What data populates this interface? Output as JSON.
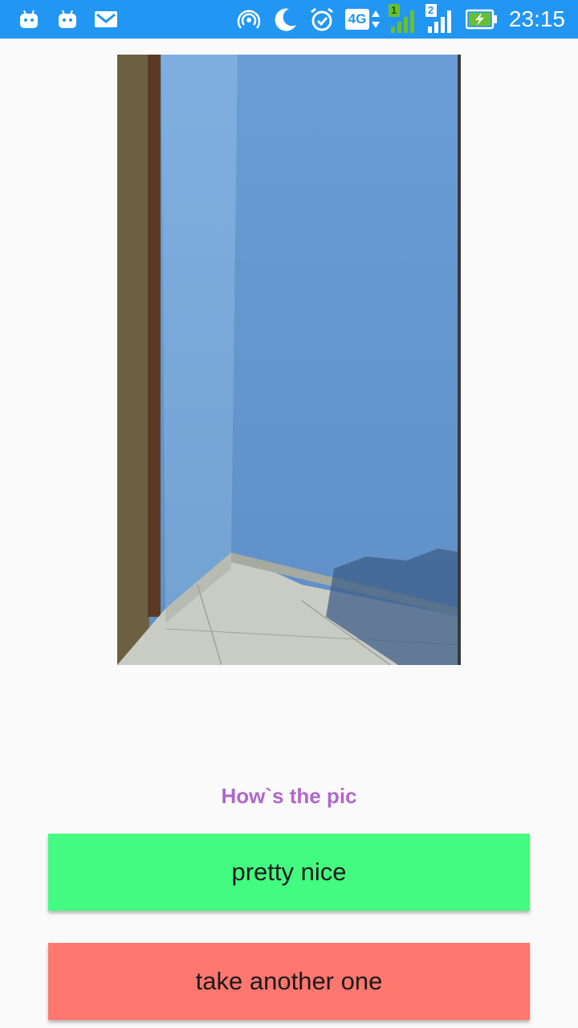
{
  "status_bar": {
    "time": "23:15",
    "network_label": "4G",
    "sim1_label": "1",
    "sim2_label": "2",
    "icons": [
      "android-icon",
      "android-icon",
      "gmail-icon",
      "hotspot-icon",
      "moon-icon",
      "alarm-icon",
      "network-4g-icon",
      "signal-sim1-icon",
      "signal-sim2-icon",
      "battery-charging-icon"
    ],
    "color": "#2196f3"
  },
  "photo": {
    "subject": "captured-photo"
  },
  "prompt": {
    "text": "How`s the pic",
    "color": "#b067cc"
  },
  "buttons": {
    "accept_label": "pretty nice",
    "accept_color": "#42fb80",
    "retake_label": "take another one",
    "retake_color": "#ff776e"
  }
}
